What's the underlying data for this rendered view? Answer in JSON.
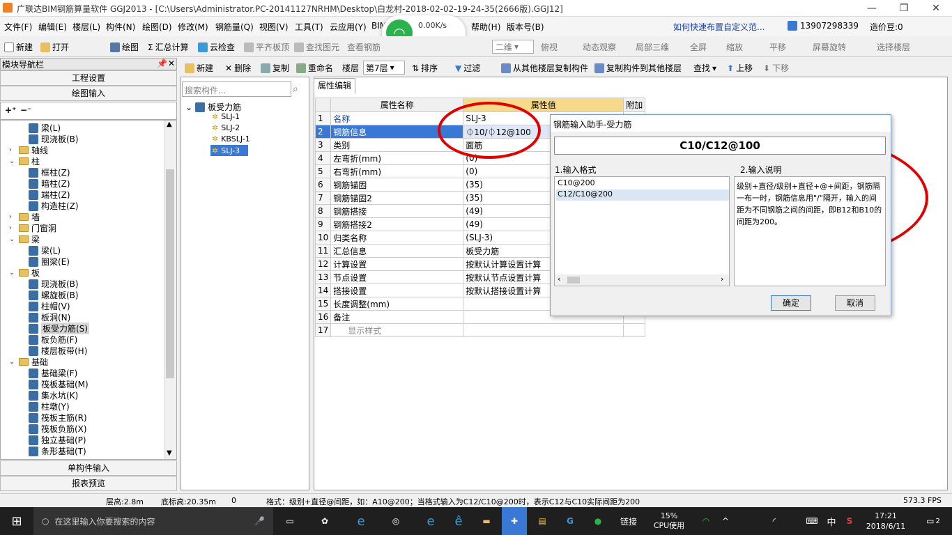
{
  "window": {
    "title": "广联达BIM钢筋算量软件 GGJ2013 - [C:\\Users\\Administrator.PC-20141127NRHM\\Desktop\\白龙村-2018-02-02-19-24-35(2666版).GGJ12]",
    "min": "—",
    "max": "❐",
    "close": "✕"
  },
  "menu": {
    "items": [
      "文件(F)",
      "编辑(E)",
      "楼层(L)",
      "构件(N)",
      "绘图(D)",
      "修改(M)",
      "钢筋量(Q)",
      "视图(V)",
      "工具(T)",
      "云应用(Y)",
      "BIM"
    ],
    "help": "帮助(H)",
    "version": "版本号(B)",
    "howto": "如何快速布置自定义范...",
    "phone": "13907298339",
    "price": "造价豆:0"
  },
  "netwidget": {
    "speed": "0.00K/s",
    "count": "0"
  },
  "toolbar1": {
    "new": "新建",
    "open": "打开",
    "draw": "绘图",
    "sum": "汇总计算",
    "cloudcheck": "云检查",
    "flatten": "平齐板顶",
    "findelem": "查找图元",
    "viewrebar": "查看钢筋",
    "view2d": "二维",
    "top": "俯视",
    "dynamic": "动态观察",
    "local3d": "局部三维",
    "fullscreen": "全屏",
    "zoom": "缩放",
    "pan": "平移",
    "rotate": "屏幕旋转",
    "selectfloor": "选择楼层"
  },
  "nav": {
    "title": "模块导航栏",
    "pin": "📌",
    "close": "✕",
    "project": "工程设置",
    "drawinput": "绘图输入",
    "single": "单构件输入",
    "report": "报表预览"
  },
  "tree": [
    {
      "t": "梁(L)",
      "lvl": 2,
      "k": "item"
    },
    {
      "t": "现浇板(B)",
      "lvl": 2,
      "k": "item"
    },
    {
      "t": "轴线",
      "lvl": 0,
      "k": "folder",
      "e": "›"
    },
    {
      "t": "柱",
      "lvl": 0,
      "k": "folder",
      "e": "⌄"
    },
    {
      "t": "框柱(Z)",
      "lvl": 1,
      "k": "item"
    },
    {
      "t": "暗柱(Z)",
      "lvl": 1,
      "k": "item"
    },
    {
      "t": "端柱(Z)",
      "lvl": 1,
      "k": "item"
    },
    {
      "t": "构造柱(Z)",
      "lvl": 1,
      "k": "item"
    },
    {
      "t": "墙",
      "lvl": 0,
      "k": "folder",
      "e": "›"
    },
    {
      "t": "门窗洞",
      "lvl": 0,
      "k": "folder",
      "e": "›"
    },
    {
      "t": "梁",
      "lvl": 0,
      "k": "folder",
      "e": "⌄"
    },
    {
      "t": "梁(L)",
      "lvl": 1,
      "k": "item"
    },
    {
      "t": "圈梁(E)",
      "lvl": 1,
      "k": "item"
    },
    {
      "t": "板",
      "lvl": 0,
      "k": "folder",
      "e": "⌄"
    },
    {
      "t": "现浇板(B)",
      "lvl": 1,
      "k": "item"
    },
    {
      "t": "螺旋板(B)",
      "lvl": 1,
      "k": "item"
    },
    {
      "t": "柱帽(V)",
      "lvl": 1,
      "k": "item"
    },
    {
      "t": "板洞(N)",
      "lvl": 1,
      "k": "item"
    },
    {
      "t": "板受力筋(S)",
      "lvl": 1,
      "k": "item",
      "sel": true
    },
    {
      "t": "板负筋(F)",
      "lvl": 1,
      "k": "item"
    },
    {
      "t": "楼层板带(H)",
      "lvl": 1,
      "k": "item"
    },
    {
      "t": "基础",
      "lvl": 0,
      "k": "folder",
      "e": "⌄"
    },
    {
      "t": "基础梁(F)",
      "lvl": 1,
      "k": "item"
    },
    {
      "t": "筏板基础(M)",
      "lvl": 1,
      "k": "item"
    },
    {
      "t": "集水坑(K)",
      "lvl": 1,
      "k": "item"
    },
    {
      "t": "柱墩(Y)",
      "lvl": 1,
      "k": "item"
    },
    {
      "t": "筏板主筋(R)",
      "lvl": 1,
      "k": "item"
    },
    {
      "t": "筏板负筋(X)",
      "lvl": 1,
      "k": "item"
    },
    {
      "t": "独立基础(P)",
      "lvl": 1,
      "k": "item"
    },
    {
      "t": "条形基础(T)",
      "lvl": 1,
      "k": "item"
    }
  ],
  "toolbar2": {
    "new": "新建",
    "delete": "删除",
    "copy": "复制",
    "rename": "重命名",
    "floor": "楼层",
    "floorval": "第7层",
    "sort": "排序",
    "filter": "过滤",
    "copyfrom": "从其他楼层复制构件",
    "copyto": "复制构件到其他楼层",
    "find": "查找",
    "up": "上移",
    "down": "下移"
  },
  "components": {
    "search_ph": "搜索构件...",
    "root": "板受力筋",
    "items": [
      "SLJ-1",
      "SLJ-2",
      "KBSLJ-1",
      "SLJ-3"
    ],
    "selected": "SLJ-3"
  },
  "props": {
    "tab": "属性编辑",
    "h_name": "属性名称",
    "h_val": "属性值",
    "h_add": "附加",
    "rows": [
      {
        "n": "1",
        "name": "名称",
        "val": "SLJ-3",
        "blue": true
      },
      {
        "n": "2",
        "name": "钢筋信息",
        "val": "⏀10/⏀12@100",
        "blue": true,
        "sel": true
      },
      {
        "n": "3",
        "name": "类别",
        "val": "面筋"
      },
      {
        "n": "4",
        "name": "左弯折(mm)",
        "val": "(0)"
      },
      {
        "n": "5",
        "name": "右弯折(mm)",
        "val": "(0)"
      },
      {
        "n": "6",
        "name": "钢筋锚固",
        "val": "(35)"
      },
      {
        "n": "7",
        "name": "钢筋锚固2",
        "val": "(35)"
      },
      {
        "n": "8",
        "name": "钢筋搭接",
        "val": "(49)"
      },
      {
        "n": "9",
        "name": "钢筋搭接2",
        "val": "(49)"
      },
      {
        "n": "10",
        "name": "归类名称",
        "val": "(SLJ-3)"
      },
      {
        "n": "11",
        "name": "汇总信息",
        "val": "板受力筋"
      },
      {
        "n": "12",
        "name": "计算设置",
        "val": "按默认计算设置计算"
      },
      {
        "n": "13",
        "name": "节点设置",
        "val": "按默认节点设置计算"
      },
      {
        "n": "14",
        "name": "搭接设置",
        "val": "按默认搭接设置计算"
      },
      {
        "n": "15",
        "name": "长度调整(mm)",
        "val": ""
      },
      {
        "n": "16",
        "name": "备注",
        "val": ""
      },
      {
        "n": "17",
        "name": "显示样式",
        "val": "",
        "gray": true
      }
    ]
  },
  "dialog": {
    "title": "钢筋输入助手-受力筋",
    "input": "C10/C12@100",
    "fmt_label": "1.输入格式",
    "desc_label": "2.输入说明",
    "formats": [
      "C10@200",
      "C12/C10@200"
    ],
    "desc": "级别+直径/级别+直径+@+间距，钢筋隔一布一时，钢筋信息用\"/\"隔开，输入的间距为不同钢筋之间的间距，即B12和B10的间距为200。",
    "ok": "确定",
    "cancel": "取消"
  },
  "status": {
    "floorh": "层高:2.8m",
    "bottom": "底标高:20.35m",
    "zero": "0",
    "hint": "格式：级别+直径@间距，如：A10@200；当格式输入为C12/C10@200时，表示C12与C10实际间距为200",
    "fps": "573.3 FPS"
  },
  "taskbar": {
    "search": "在这里输入你要搜索的内容",
    "link": "链接",
    "cpu": "15%",
    "cpulabel": "CPU使用",
    "ime": "中",
    "time": "17:21",
    "date": "2018/6/11",
    "notify": "2"
  }
}
